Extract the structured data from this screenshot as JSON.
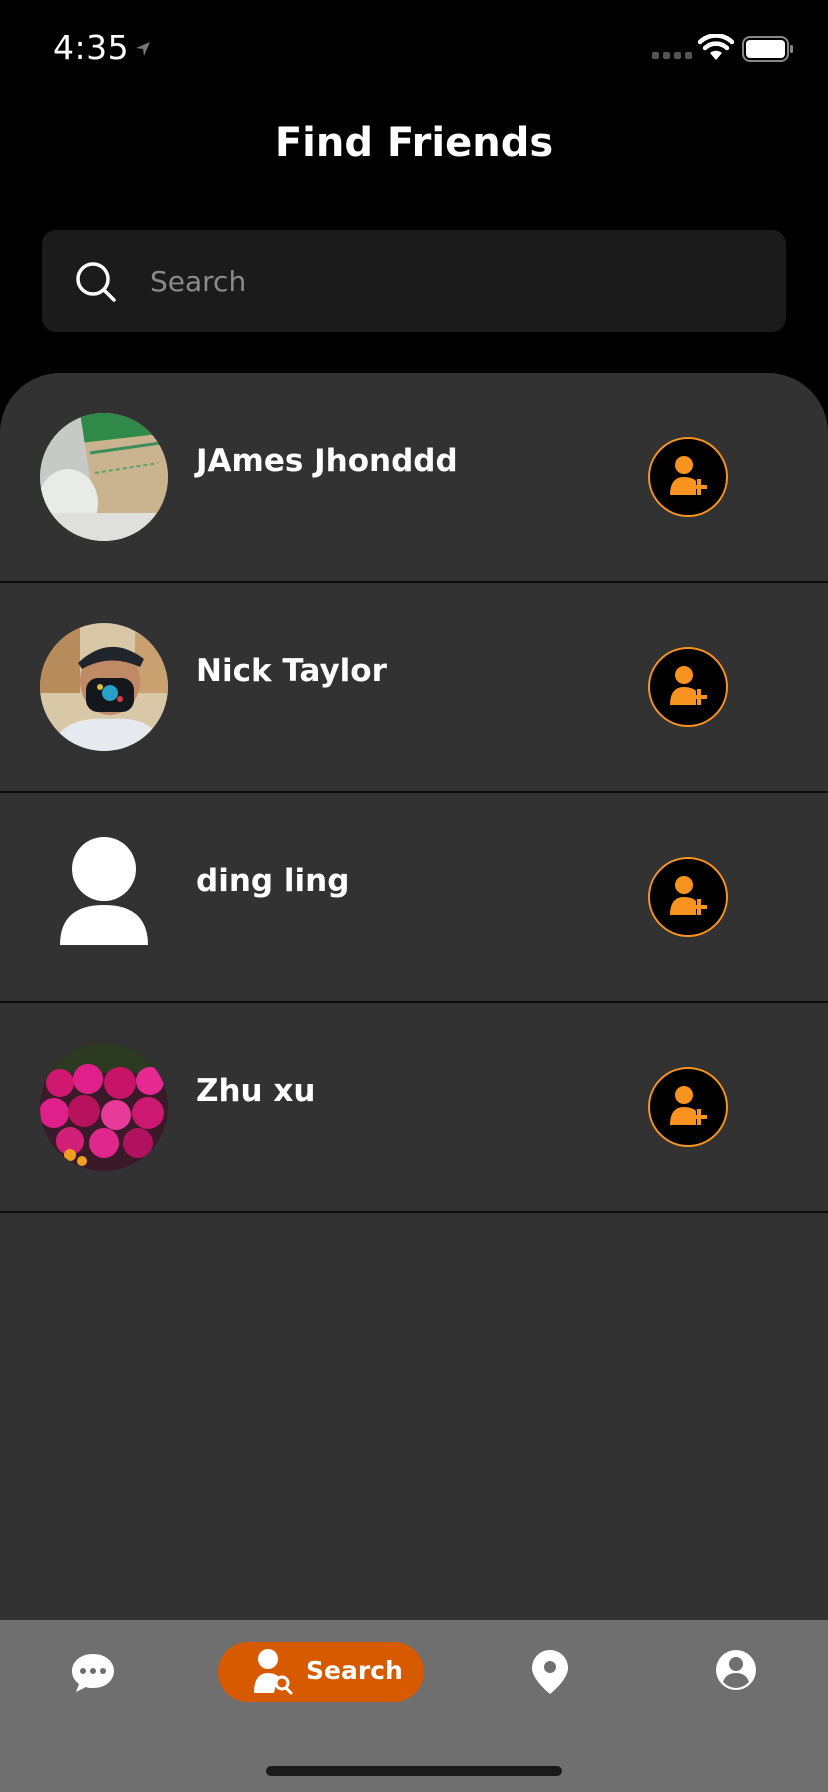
{
  "status_bar": {
    "time": "4:35"
  },
  "header": {
    "title": "Find Friends"
  },
  "search": {
    "placeholder": "Search",
    "value": ""
  },
  "friends": [
    {
      "name": "JAmes Jhonddd",
      "avatar": "photo-paper-box"
    },
    {
      "name": "Nick Taylor",
      "avatar": "photo-man-mask"
    },
    {
      "name": "ding ling",
      "avatar": "default-user"
    },
    {
      "name": "Zhu xu",
      "avatar": "photo-flowers"
    }
  ],
  "tab_bar": {
    "tabs": [
      {
        "name": "chat-icon",
        "label": ""
      },
      {
        "name": "search-user-icon",
        "label": "Search",
        "active": true
      },
      {
        "name": "location-pin-icon",
        "label": ""
      },
      {
        "name": "profile-icon",
        "label": ""
      }
    ]
  },
  "colors": {
    "accent": "#f7931e",
    "active_tab": "#d75a00",
    "panel": "#323232",
    "search_bg": "#1b1b1b",
    "tab_bar": "#6f6f6f"
  }
}
